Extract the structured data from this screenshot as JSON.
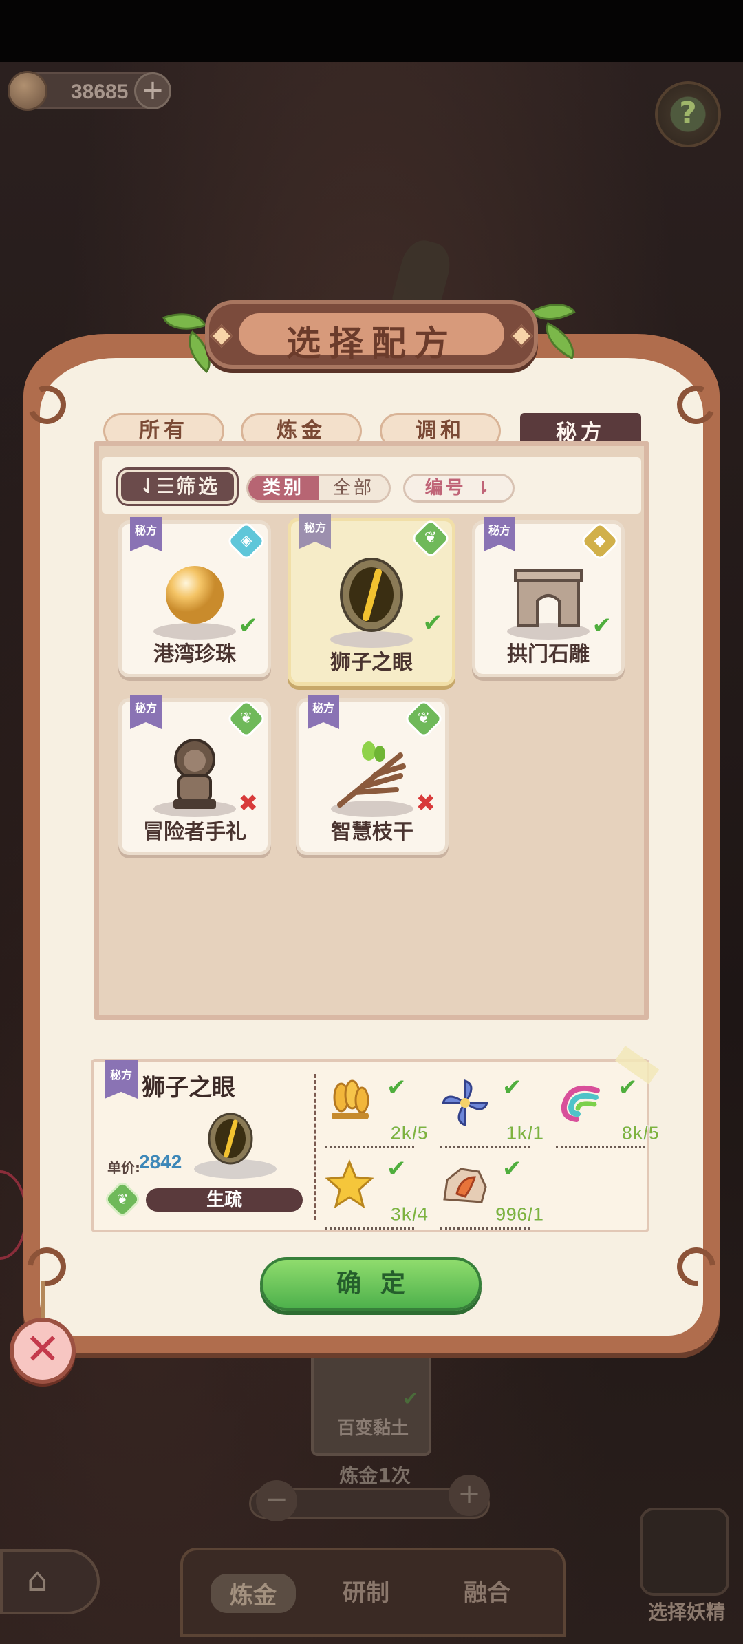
{
  "hud": {
    "coins": "38685"
  },
  "dialog": {
    "title": "选择配方",
    "tabs": [
      {
        "label": "所有",
        "active": false
      },
      {
        "label": "炼金",
        "active": false
      },
      {
        "label": "调和",
        "active": false
      },
      {
        "label": "秘方",
        "active": true
      }
    ],
    "filter": {
      "button_label": "筛选",
      "category_label": "类别",
      "category_value": "全部",
      "sort_label": "编号"
    },
    "recipes": [
      {
        "name": "港湾珍珠",
        "badge": "秘方",
        "attr": "water",
        "attr_color": "#5fc6d9",
        "status": "ok",
        "selected": false
      },
      {
        "name": "狮子之眼",
        "badge": "秘方",
        "attr": "plant",
        "attr_color": "#6fb95a",
        "status": "ok",
        "selected": true
      },
      {
        "name": "拱门石雕",
        "badge": "秘方",
        "attr": "earth",
        "attr_color": "#d1b04a",
        "status": "ok",
        "selected": false
      },
      {
        "name": "冒险者手礼",
        "badge": "秘方",
        "attr": "plant",
        "attr_color": "#6fb95a",
        "status": "no",
        "selected": false
      },
      {
        "name": "智慧枝干",
        "badge": "秘方",
        "attr": "plant",
        "attr_color": "#6fb95a",
        "status": "no",
        "selected": false
      }
    ],
    "detail": {
      "badge": "秘方",
      "name": "狮子之眼",
      "price_label": "单价:",
      "price": "2842",
      "tag": "生疏",
      "ingredients": [
        {
          "icon": "wheat-icon",
          "count": "2k/5"
        },
        {
          "icon": "pinwheel-flower-icon",
          "count": "1k/1"
        },
        {
          "icon": "rainbow-feather-icon",
          "count": "8k/5"
        },
        {
          "icon": "star-icon",
          "count": "3k/4"
        },
        {
          "icon": "ore-icon",
          "count": "996/1"
        }
      ]
    },
    "confirm_label": "确定"
  },
  "scene": {
    "card_label": "百变黏土",
    "times_label": "炼金1次",
    "bottom_tabs": [
      "炼金",
      "研制",
      "融合"
    ],
    "spirit_label": "选择妖精"
  },
  "colors": {
    "accent_green": "#4eb14c",
    "tab_active": "#5a3a3c",
    "badge_purple": "#8a73b4",
    "price_blue": "#3d87b8"
  }
}
